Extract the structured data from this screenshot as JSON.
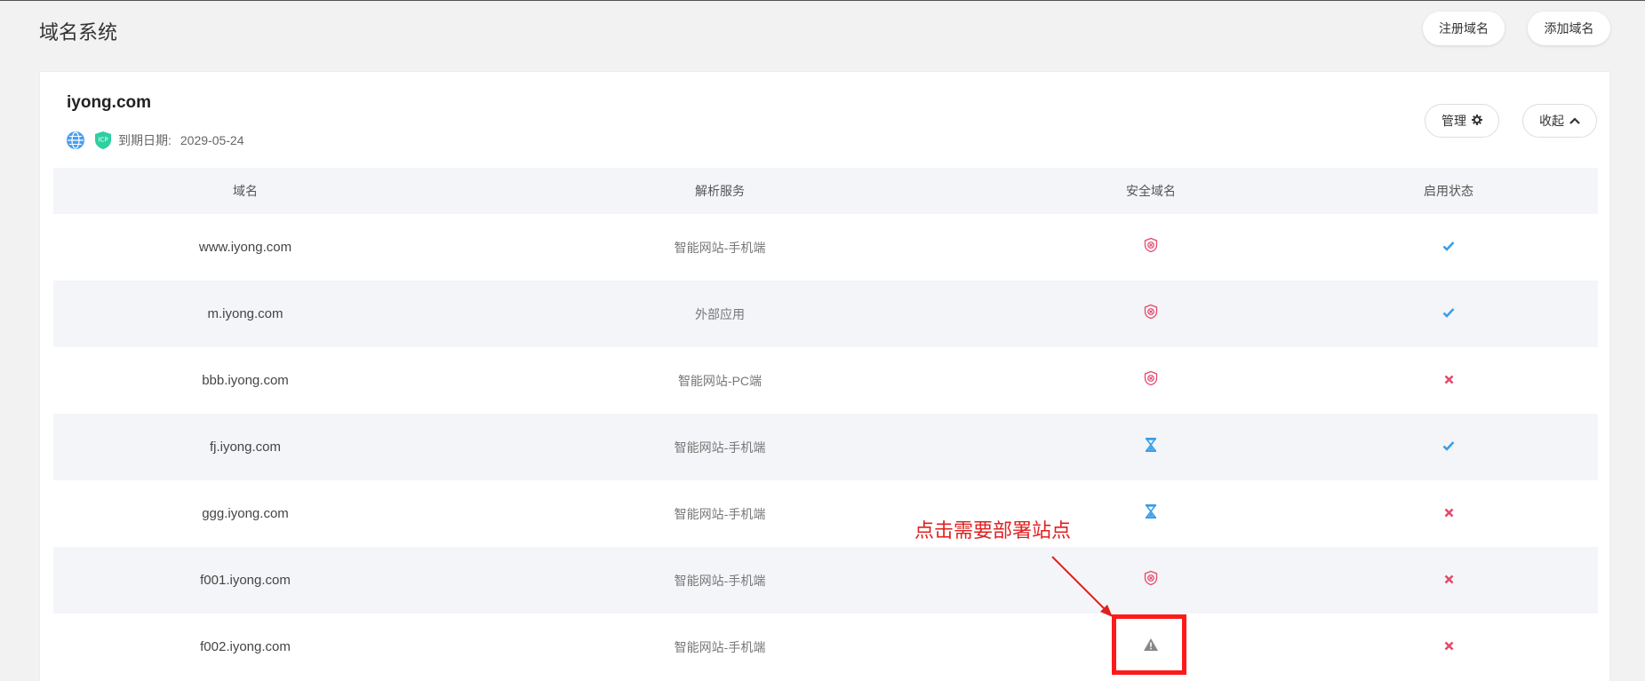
{
  "header": {
    "title": "域名系统",
    "register_label": "注册域名",
    "add_label": "添加域名"
  },
  "domain_card": {
    "name": "iyong.com",
    "icp_badge": "ICP",
    "expiry_label": "到期日期:",
    "expiry_date": "2029-05-24",
    "manage_label": "管理",
    "collapse_label": "收起"
  },
  "table": {
    "columns": [
      "域名",
      "解析服务",
      "安全域名",
      "启用状态"
    ],
    "rows": [
      {
        "domain": "www.iyong.com",
        "service": "智能网站-手机端",
        "security": "shield-x",
        "enabled": true
      },
      {
        "domain": "m.iyong.com",
        "service": "外部应用",
        "security": "shield-x",
        "enabled": true
      },
      {
        "domain": "bbb.iyong.com",
        "service": "智能网站-PC端",
        "security": "shield-x",
        "enabled": false
      },
      {
        "domain": "fj.iyong.com",
        "service": "智能网站-手机端",
        "security": "hourglass",
        "enabled": true
      },
      {
        "domain": "ggg.iyong.com",
        "service": "智能网站-手机端",
        "security": "hourglass",
        "enabled": false
      },
      {
        "domain": "f001.iyong.com",
        "service": "智能网站-手机端",
        "security": "shield-x",
        "enabled": false
      },
      {
        "domain": "f002.iyong.com",
        "service": "智能网站-手机端",
        "security": "warning",
        "enabled": false
      }
    ]
  },
  "annotation": {
    "text": "点击需要部署站点"
  },
  "colors": {
    "check": "#3a9ee8",
    "cross": "#e5486b",
    "shield": "#e5486b",
    "hourglass": "#3a9ee8",
    "warning": "#888888",
    "annotation": "#e02020"
  }
}
